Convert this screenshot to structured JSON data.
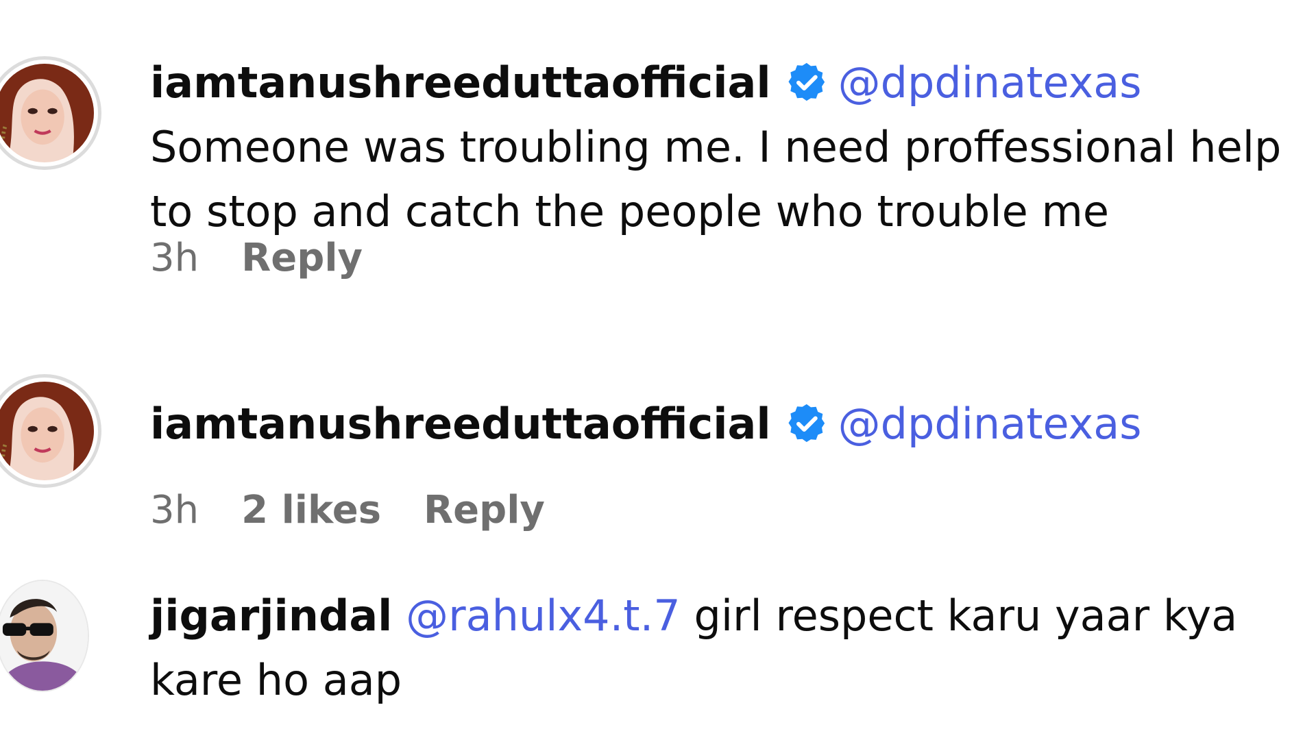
{
  "comments": [
    {
      "username": "iamtanushreeduttaofficial",
      "verified": true,
      "mention": "@dpdinatexas",
      "text": " Someone was troubling me. I need proffessional help to stop and catch the people who trouble me",
      "time": "3h",
      "likes": "",
      "reply_label": "Reply"
    },
    {
      "username": "iamtanushreeduttaofficial",
      "verified": true,
      "mention": "@dpdinatexas",
      "text": "",
      "time": "3h",
      "likes": "2 likes",
      "reply_label": "Reply"
    },
    {
      "username": "jigarjindal",
      "verified": false,
      "mention": "@rahulx4.t.7",
      "text": " girl respect karu yaar kya kare ho aap",
      "time": "",
      "likes": "",
      "reply_label": ""
    }
  ],
  "colors": {
    "mention": "#4a5fe0",
    "verified": "#1d8cf8",
    "meta": "#6f6f6f"
  },
  "icons": {
    "verified": "verified-badge-icon"
  }
}
